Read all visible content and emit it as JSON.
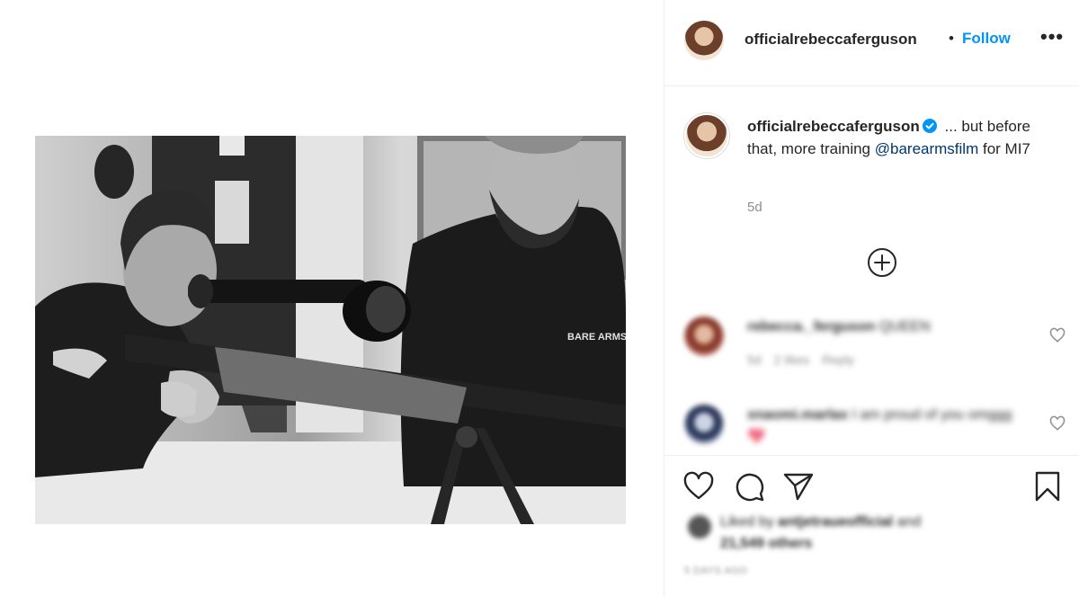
{
  "post": {
    "image_alt": "Black and white photo of a woman aiming a scoped rifle with an instructor in a BARE ARMS t-shirt beside her",
    "shirt_text": "BARE ARMS"
  },
  "header": {
    "username": "officialrebeccaferguson",
    "separator": "•",
    "follow_label": "Follow",
    "more_label": "•••"
  },
  "caption": {
    "username": "officialrebeccaferguson",
    "verified_icon": "verified-badge-icon",
    "text_before": " ... but before that, more training ",
    "mention": "@barearmsfilm",
    "text_after": " for MI7",
    "time": "5d"
  },
  "comments": [
    {
      "username": "rebecca._ferguson",
      "text": " QUEEN",
      "time": "5d",
      "likes": "2 likes",
      "reply": "Reply"
    },
    {
      "username": "xnaomi.marlax",
      "text": " I am proud of you omggg 💖",
      "time": "",
      "likes": "",
      "reply": ""
    }
  ],
  "actions": {
    "icons": [
      "heart-icon",
      "comment-icon",
      "share-icon",
      "bookmark-icon"
    ],
    "liked_by_prefix": "Liked by ",
    "liked_by_user": "antjetraueofficial",
    "liked_by_and": " and",
    "others": "21,549 others",
    "date": "5 DAYS AGO"
  },
  "colors": {
    "accent": "#0095f6",
    "mention": "#00376b",
    "muted": "#8e8e8e",
    "text": "#262626",
    "divider": "#efefef"
  }
}
